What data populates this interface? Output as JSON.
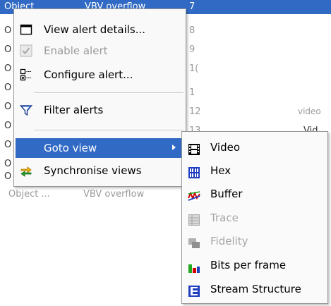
{
  "background": {
    "header": [
      "Object",
      "VBV overflow",
      "7"
    ],
    "left_chars": [
      "O",
      "O",
      "O",
      "O",
      "O",
      "O",
      "O",
      "O",
      "O"
    ],
    "right_nums": [
      "8",
      "9",
      "1(",
      "1",
      "12",
      "13"
    ],
    "right_words": [
      "video",
      "Vid"
    ],
    "bottom_row": [
      "Object ...",
      "VBV overflow"
    ]
  },
  "menu": {
    "items": [
      {
        "label": "View alert details...",
        "icon": "window-icon",
        "enabled": true
      },
      {
        "label": "Enable alert",
        "icon": "checkmark-icon",
        "enabled": false
      },
      {
        "label": "Configure alert...",
        "icon": "configure-icon",
        "enabled": true
      },
      {
        "label": "Filter alerts",
        "icon": "filter-icon",
        "enabled": true
      },
      {
        "label": "Goto view",
        "icon": "",
        "enabled": true,
        "selected": true,
        "has_submenu": true
      },
      {
        "label": "Synchronise views",
        "icon": "sync-arrows-icon",
        "enabled": true
      }
    ]
  },
  "submenu": {
    "items": [
      {
        "label": "Video",
        "icon": "film-icon",
        "enabled": true
      },
      {
        "label": "Hex",
        "icon": "hex-icon",
        "enabled": true
      },
      {
        "label": "Buffer",
        "icon": "buffer-graph-icon",
        "enabled": true
      },
      {
        "label": "Trace",
        "icon": "table-icon",
        "enabled": false
      },
      {
        "label": "Fidelity",
        "icon": "fidelity-icon",
        "enabled": false
      },
      {
        "label": "Bits per frame",
        "icon": "bar-chart-icon",
        "enabled": true
      },
      {
        "label": "Stream Structure",
        "icon": "structure-icon",
        "enabled": true
      }
    ]
  },
  "colors": {
    "selection": "#316ac5",
    "menu_bg": "#f9f9f9",
    "disabled_text": "#9a9a9a"
  }
}
